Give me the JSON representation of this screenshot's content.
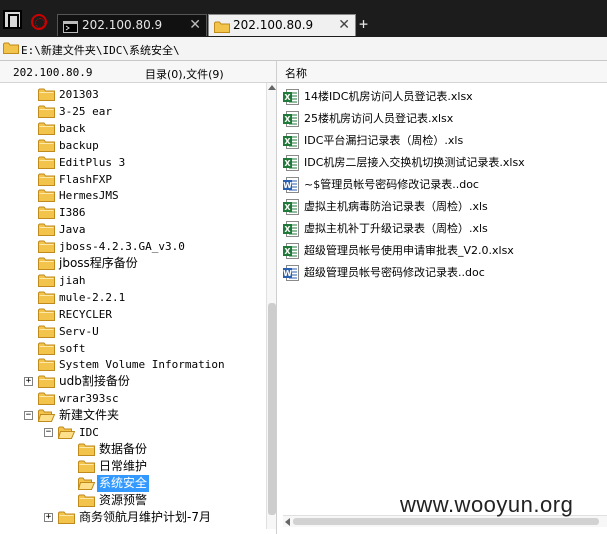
{
  "tabs": [
    {
      "label": "202.100.80.9",
      "icon": "terminal-icon",
      "active": false
    },
    {
      "label": "202.100.80.9",
      "icon": "folder-icon",
      "active": true
    }
  ],
  "tab_close_glyph": "✕",
  "tab_add_glyph": "+",
  "path": "E:\\新建文件夹\\IDC\\系统安全\\",
  "left_header": {
    "host": "202.100.80.9",
    "counts": "目录(0),文件(9)"
  },
  "right_header": {
    "name": "名称"
  },
  "tree": [
    {
      "label": "201303",
      "level": 1
    },
    {
      "label": "3-25 ear",
      "level": 1
    },
    {
      "label": "back",
      "level": 1
    },
    {
      "label": "backup",
      "level": 1
    },
    {
      "label": "EditPlus 3",
      "level": 1
    },
    {
      "label": "FlashFXP",
      "level": 1
    },
    {
      "label": "HermesJMS",
      "level": 1
    },
    {
      "label": "I386",
      "level": 1
    },
    {
      "label": "Java",
      "level": 1
    },
    {
      "label": "jboss-4.2.3.GA_v3.0",
      "level": 1
    },
    {
      "label": "jboss程序备份",
      "level": 1
    },
    {
      "label": "jiah",
      "level": 1
    },
    {
      "label": "mule-2.2.1",
      "level": 1
    },
    {
      "label": "RECYCLER",
      "level": 1
    },
    {
      "label": "Serv-U",
      "level": 1
    },
    {
      "label": "soft",
      "level": 1
    },
    {
      "label": "System Volume Information",
      "level": 1
    },
    {
      "label": "udb割接备份",
      "level": 1,
      "expander": "+"
    },
    {
      "label": "wrar393sc",
      "level": 1
    },
    {
      "label": "新建文件夹",
      "level": 1,
      "expander": "−",
      "open": true
    },
    {
      "label": "IDC",
      "level": 2,
      "expander": "−",
      "open": true
    },
    {
      "label": "数据备份",
      "level": 3
    },
    {
      "label": "日常维护",
      "level": 3
    },
    {
      "label": "系统安全",
      "level": 3,
      "selected": true,
      "open": true
    },
    {
      "label": "资源预警",
      "level": 3
    },
    {
      "label": "商务领航月维护计划-7月",
      "level": 2,
      "expander": "+"
    }
  ],
  "files": [
    {
      "name": "14楼IDC机房访问人员登记表.xlsx",
      "type": "xls"
    },
    {
      "name": "25楼机房访问人员登记表.xlsx",
      "type": "xls"
    },
    {
      "name": "IDC平台漏扫记录表（周检）.xls",
      "type": "xls"
    },
    {
      "name": "IDC机房二层接入交换机切换测试记录表.xlsx",
      "type": "xls"
    },
    {
      "name": "~$管理员帐号密码修改记录表..doc",
      "type": "doc"
    },
    {
      "name": "虚拟主机病毒防治记录表（周检）.xls",
      "type": "xls"
    },
    {
      "name": "虚拟主机补丁升级记录表（周检）.xls",
      "type": "xls"
    },
    {
      "name": "超级管理员帐号使用申请审批表_V2.0.xlsx",
      "type": "xls"
    },
    {
      "name": "超级管理员帐号密码修改记录表..doc",
      "type": "doc"
    }
  ],
  "colors": {
    "folder": "#f3c44b",
    "folder_edge": "#c08a1c",
    "xls": "#1f7a3a",
    "doc": "#2b5fb0",
    "selection": "#3399ff"
  },
  "watermark": "www.wooyun.org"
}
